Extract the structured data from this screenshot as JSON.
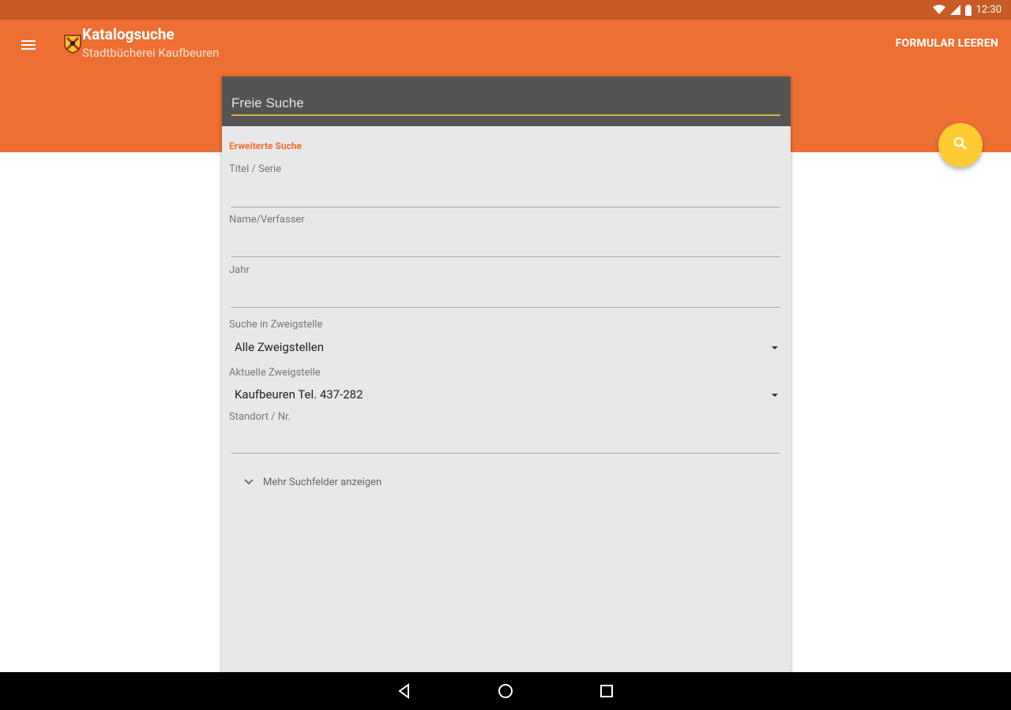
{
  "status_bar": {
    "time": "12:30",
    "icons": [
      "wifi-icon",
      "cell-signal-icon",
      "battery-icon"
    ]
  },
  "app_bar": {
    "title": "Katalogsuche",
    "subtitle": "Stadtbücherei Kaufbeuren",
    "action_label": "FORMULAR LEEREN",
    "menu_icon": "menu-icon",
    "logo_icon": "library-logo-icon"
  },
  "search_form": {
    "free_search_placeholder": "Freie Suche",
    "free_search_value": "",
    "section_label": "Erweiterte Suche",
    "title_label": "Titel / Serie",
    "author_label": "Name/Verfasser",
    "year_label": "Jahr",
    "branch_label": "Suche in Zweigstelle",
    "branch_value": "Alle Zweigstellen",
    "current_branch_label": "Aktuelle Zweigstelle",
    "current_branch_value": "Kaufbeuren Tel. 437-282",
    "location_label": "Standort / Nr.",
    "more_fields_label": "Mehr Suchfelder anzeigen"
  },
  "fab": {
    "icon": "search-icon"
  },
  "nav_bar": {
    "icons": [
      "back-icon",
      "home-icon",
      "recents-icon"
    ]
  },
  "colors": {
    "primary": "#ee6f33",
    "primary_dark": "#c85a25",
    "accent": "#fdcc33",
    "card_header": "#545454",
    "card_background": "#e8e8e8"
  }
}
